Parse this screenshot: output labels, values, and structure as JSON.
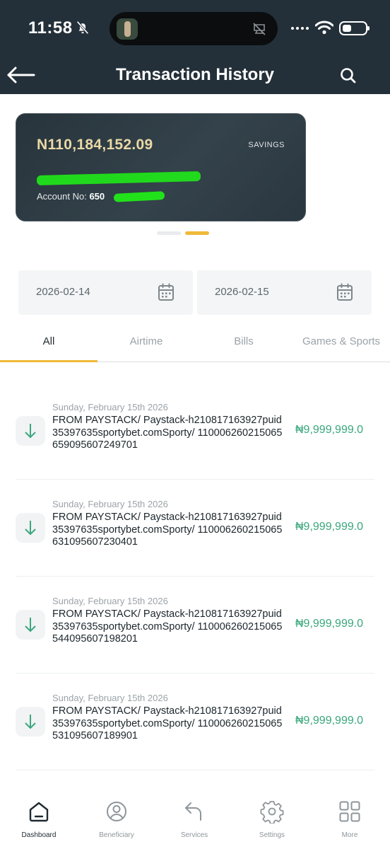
{
  "status_bar": {
    "time": "11:58"
  },
  "header": {
    "title": "Transaction History"
  },
  "account_card": {
    "balance": "N110,184,152.09",
    "type": "SAVINGS",
    "account_label": "Account No:",
    "account_number_visible": "650"
  },
  "filters": {
    "from_date": "2026-02-14",
    "to_date": "2026-02-15"
  },
  "tabs": [
    {
      "label": "All"
    },
    {
      "label": "Airtime"
    },
    {
      "label": "Bills"
    },
    {
      "label": "Games & Sports"
    }
  ],
  "transactions": [
    {
      "date": "Sunday, February 15th 2026",
      "description": "FROM PAYSTACK/ Paystack-h210817163927puid35397635sportybet.comSporty/ 110006260215065659095607249701",
      "amount": "₦9,999,999.0"
    },
    {
      "date": "Sunday, February 15th 2026",
      "description": "FROM PAYSTACK/ Paystack-h210817163927puid35397635sportybet.comSporty/ 110006260215065631095607230401",
      "amount": "₦9,999,999.0"
    },
    {
      "date": "Sunday, February 15th 2026",
      "description": "FROM PAYSTACK/ Paystack-h210817163927puid35397635sportybet.comSporty/ 110006260215065544095607198201",
      "amount": "₦9,999,999.0"
    },
    {
      "date": "Sunday, February 15th 2026",
      "description": "FROM PAYSTACK/ Paystack-h210817163927puid35397635sportybet.comSporty/ 110006260215065531095607189901",
      "amount": "₦9,999,999.0"
    }
  ],
  "bottom_nav": [
    {
      "label": "Dashboard",
      "icon": "home-icon"
    },
    {
      "label": "Beneficiary",
      "icon": "user-icon"
    },
    {
      "label": "Services",
      "icon": "reply-arrow-icon"
    },
    {
      "label": "Settings",
      "icon": "gear-icon"
    },
    {
      "label": "More",
      "icon": "grid-icon"
    }
  ],
  "colors": {
    "header_bg": "#243039",
    "accent": "#f0b93a",
    "credit_green": "#3aa77c",
    "balance_gold": "#ead9a6"
  }
}
